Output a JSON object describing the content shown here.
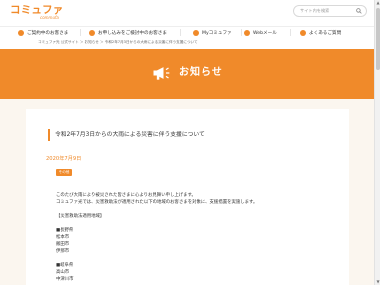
{
  "brand": {
    "logo_main": "コミュファ",
    "logo_sub": "commufa"
  },
  "search": {
    "placeholder": "サイト内を検索"
  },
  "nav": {
    "items": [
      {
        "label": "ご契約中のお客さま"
      },
      {
        "label": "お申し込みをご検討中のお客さま"
      },
      {
        "label": "Myコミュファ"
      },
      {
        "label": "Webメール"
      },
      {
        "label": "よくあるご質問"
      }
    ]
  },
  "breadcrumb": {
    "text": "コミュファ光 公式サイト ＞ お知らせ ＞ 令和2年7月3日からの大雨による災害に伴う支援について"
  },
  "hero": {
    "title": "お知らせ"
  },
  "article": {
    "title": "令和2年7月3日からの大雨による災害に伴う支援について",
    "date": "2020年7月9日",
    "category": "その他",
    "lines": [
      "このたび大雨により被災された皆さまに心よりお見舞い申し上げます。",
      "コミュファ光では、災害救助法が適用された以下の地域のお客さまを対象に、支援措置を実施します。",
      "【災害救助法適用地域】",
      "■長野県",
      "松本市",
      "飯田市",
      "伊那市",
      "■岐阜県",
      "高山市",
      "中津川市"
    ]
  },
  "colors": {
    "accent": "#f08a2a",
    "content_bg": "#fbf6ef"
  }
}
